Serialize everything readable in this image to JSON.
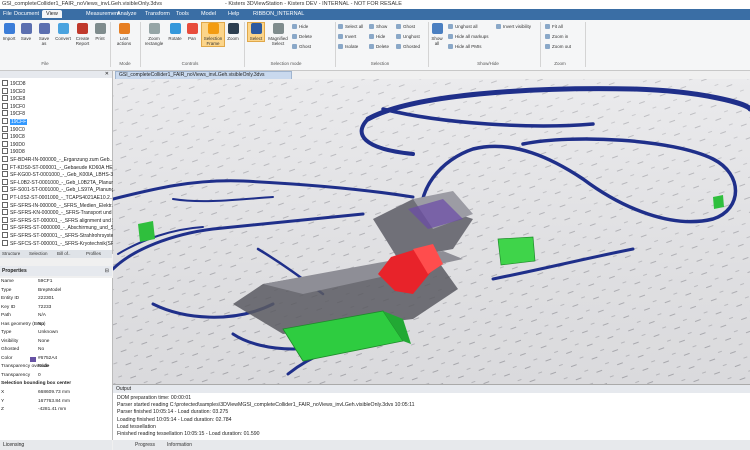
{
  "window": {
    "title_file": "GSI_completeCollider1_FAIR_noViews_invLGeh.visibleOnly.3dvs",
    "title_app": "- Kisters 3DViewStation - Kisters DEV - INTERNAL - NOT FOR RESALE"
  },
  "menu": {
    "file": "File",
    "tabs": [
      "Document",
      "View",
      "Measurement",
      "Analyze",
      "Transform",
      "Tools",
      "Model",
      "Help",
      "RIBBON_INTERNAL"
    ]
  },
  "ribbon": {
    "file_group": {
      "buttons": [
        "Import",
        "Save",
        "Save as",
        "Convert",
        "Create Report",
        "Print"
      ],
      "label": "File"
    },
    "mode_group": {
      "buttons": [
        "Last actions"
      ],
      "label": "Mode"
    },
    "controls_group": {
      "buttons": [
        "Zoom rectangle",
        "Rotate",
        "Pan",
        "Selection Frame",
        "Zoom"
      ],
      "label": "Controls"
    },
    "selection_mode_group": {
      "buttons": [
        "Select",
        "Magnified Select"
      ],
      "small": [
        "Hide",
        "Delete",
        "Ghost"
      ],
      "label": "Selection mode"
    },
    "selection_group": {
      "small": [
        "Select all",
        "Invert",
        "Isolate",
        "Show",
        "Hide",
        "Delete",
        "Ghost",
        "Unghost",
        "Ghosted"
      ],
      "label": "Selection"
    },
    "show_hide_group": {
      "buttons": [
        "Show all"
      ],
      "small": [
        "Unghost all",
        "Hide all markups",
        "Hide all PMIs",
        "Invert visibility"
      ],
      "label": "Show/Hide"
    },
    "zoom_group": {
      "small": [
        "Fit all",
        "Zoom in",
        "Zoom out"
      ],
      "label": "Zoom"
    }
  },
  "tree": {
    "items": [
      {
        "label": "19CD8",
        "selected": false
      },
      {
        "label": "19CE0",
        "selected": false
      },
      {
        "label": "19CE8",
        "selected": false
      },
      {
        "label": "19CF0",
        "selected": false
      },
      {
        "label": "19CF8",
        "selected": false
      },
      {
        "label": "19CFF",
        "selected": true
      },
      {
        "label": "190C0",
        "selected": false
      },
      {
        "label": "190C8",
        "selected": false
      },
      {
        "label": "190D0",
        "selected": false
      },
      {
        "label": "190D8",
        "selected": false
      },
      {
        "label": "SF-BD4R-IN-000000_-_Erganzung zum Geb..",
        "selected": false
      },
      {
        "label": "FT-KDS0-ST-000001_-_Gebaeude KD60A HE..",
        "selected": false
      },
      {
        "label": "SF-KG00-ST-0001000_-_Geb_K00IA_LBHS-3_H..",
        "selected": false
      },
      {
        "label": "SF-L0B2-ST-0001000_-_Geb_L0B2TA_Planungs..",
        "selected": false
      },
      {
        "label": "SF-S001-ST-0001000_-_Geb_LS97A_Planungs..",
        "selected": false
      },
      {
        "label": "PT-L0S2-ST-0001000_-_TCAPS4021AE10.2..",
        "selected": false
      },
      {
        "label": "SF-SFRS-IN-000000_-_SFRS_Medien_Elektr..",
        "selected": false
      },
      {
        "label": "SF-SFRS-KN-000000_-_SFRS-Transport und Lo..",
        "selected": false
      },
      {
        "label": "SF-SFRS-ST-000001_-_SFRS alignment und Sc..",
        "selected": false
      },
      {
        "label": "SF-SFRS-ST-0000000_-_Abschirmung_und_Sh..",
        "selected": false
      },
      {
        "label": "SF-SFRS-ST-000001_-_SFRS-Strahlrohrsystem..",
        "selected": false
      },
      {
        "label": "SF-SFCS-ST-000001_-_SFRS-Kryotechnik(SFRS..",
        "selected": false
      }
    ]
  },
  "left_tabs": [
    "Structure",
    "Selection",
    "Bill of..",
    "Profiles"
  ],
  "properties": {
    "header": "Properties",
    "rows": [
      {
        "key": "Name",
        "value": "59CF1"
      },
      {
        "key": "Type",
        "value": "BrepModel"
      },
      {
        "key": "Entity ID",
        "value": "222301"
      },
      {
        "key": "Key ID",
        "value": "72233"
      },
      {
        "key": "Path",
        "value": "N/A"
      },
      {
        "key": "Has geometry (Brep)",
        "value": "No"
      },
      {
        "key": "Type",
        "value": "Unknown"
      },
      {
        "key": "Visibility",
        "value": "None"
      },
      {
        "key": "Ghosted",
        "value": "No"
      },
      {
        "key": "Color",
        "value": "#6752A4"
      },
      {
        "key": "Transparency override",
        "value": "Node"
      },
      {
        "key": "Transparency",
        "value": "0"
      }
    ],
    "section": "Selection bounding box center",
    "bbox_rows": [
      {
        "key": "X",
        "value": "668609.73 mm"
      },
      {
        "key": "Y",
        "value": "167763.84 mm"
      },
      {
        "key": "Z",
        "value": "-4281.41 mm"
      }
    ]
  },
  "viewport": {
    "tab_label": "GSI_completeCollider1_FAIR_noViews_invLGeh.visibleOnly.3dvs"
  },
  "output": {
    "title": "Output",
    "lines": [
      "DOM preparation time: 00:00:01",
      "Parser started reading C:\\protected\\samples\\3DViewMGSI_completeCollider1_FAIR_noViews_invLGeh.visibleOnly.3dvs 10:05:11",
      "Parser finished 10:05:14 - Load duration: 03.275",
      "Loading finished 10:05:14 - Load duration: 02.784",
      "Load tessellation",
      "Finished reading tessellation 10:05:15 - Load duration: 01.590"
    ]
  },
  "bottom_tabs": [
    "Progress",
    "Information"
  ],
  "status": {
    "label": "Licensing"
  },
  "colors": {
    "menubar": "#3a6ea5",
    "selection": "#3399ff",
    "beamline": "#1f2f8a",
    "highlight_red": "#e8232a",
    "green_object": "#2ecc40"
  }
}
